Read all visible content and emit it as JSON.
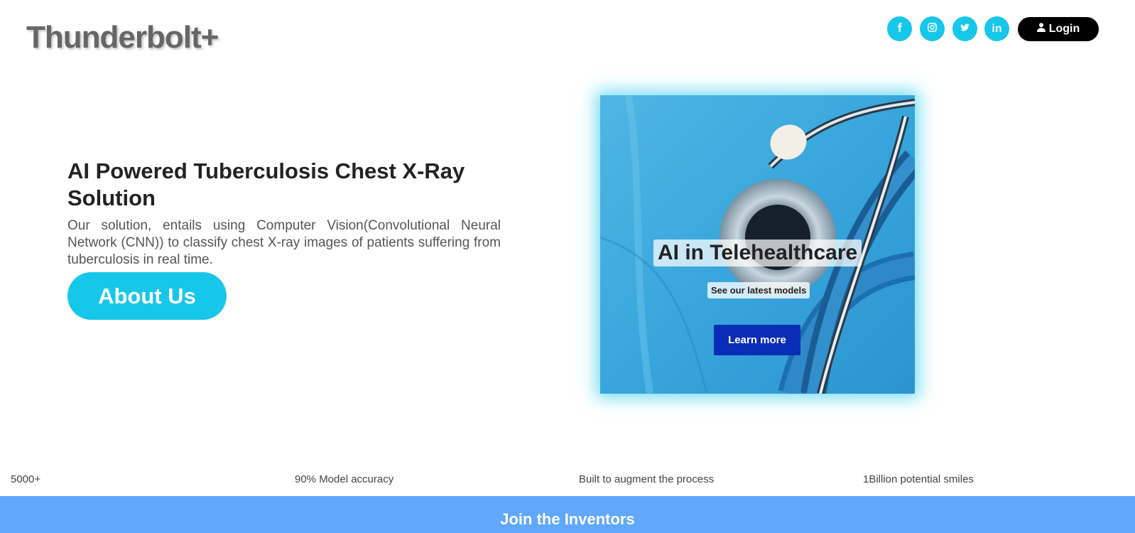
{
  "header": {
    "brand": "Thunderbolt+",
    "social": [
      {
        "icon": "facebook-icon"
      },
      {
        "icon": "instagram-icon"
      },
      {
        "icon": "twitter-icon"
      },
      {
        "icon": "linkedin-icon",
        "text": "in"
      }
    ],
    "login_label": "Login",
    "login_icon": "user-icon"
  },
  "hero": {
    "title": "AI Powered Tuberculosis Chest X-Ray Solution",
    "description": "Our solution, entails using Computer Vision(Convolutional Neural Network (CNN)) to classify chest X-ray images of patients suffering from tuberculosis in real time.",
    "about_label": "About Us"
  },
  "card": {
    "title": "AI in Telehealthcare",
    "subtitle": "See our latest models",
    "button_label": "Learn more",
    "image_icon": "stethoscope-image"
  },
  "stats": [
    "5000+",
    "90% Model accuracy",
    "Built to augment the process",
    "1Billion potential smiles"
  ],
  "footer": {
    "join_label": "Join the Inventors"
  },
  "colors": {
    "accent": "#17c7ea",
    "join_bar": "#5fa8fc",
    "learn_button": "#0a2db7"
  }
}
